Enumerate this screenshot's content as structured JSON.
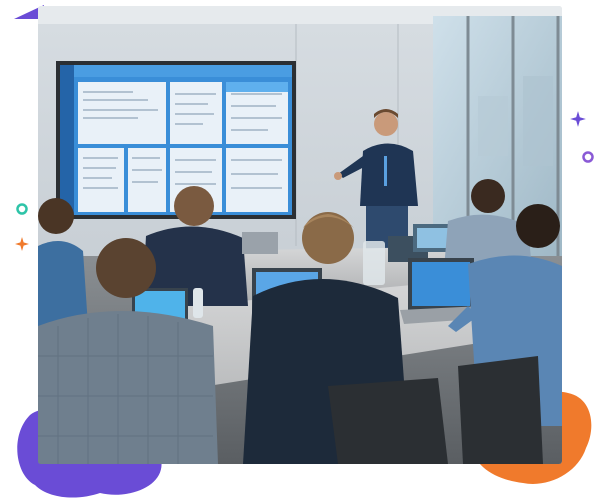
{
  "scene": {
    "description_tag": "photo",
    "colors": {
      "accent_purple": "#6a4cd6",
      "accent_orange": "#f07a2c",
      "accent_teal": "#2ec4a8",
      "screen_blue": "#3a8ed8"
    }
  },
  "decorations": {
    "plus_icon_left": "orange-plus-icon",
    "plus_icon_right": "purple-plus-icon",
    "ring_icon_left": "teal-ring-icon",
    "ring_icon_right": "purple-ring-icon"
  }
}
